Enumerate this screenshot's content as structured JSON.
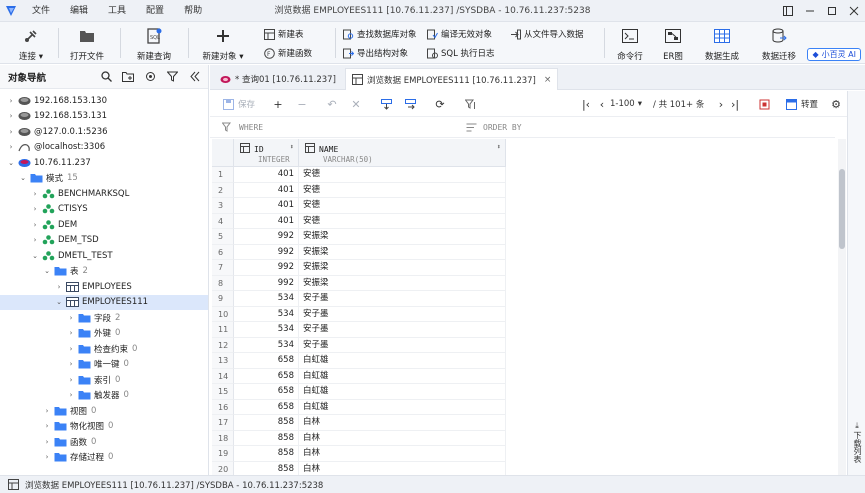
{
  "window": {
    "title": "浏览数据 EMPLOYEES111 [10.76.11.237] /SYSDBA - 10.76.11.237:5238",
    "menu": [
      "文件",
      "编辑",
      "工具",
      "配置",
      "帮助"
    ]
  },
  "toolbar": {
    "connect": "连接",
    "open_file": "打开文件",
    "new_query": "新建查询",
    "new_object": "新建对象",
    "new_table": "新建表",
    "new_function": "新建函数",
    "find_db_object": "查找数据库对象",
    "export_structure": "导出结构对象",
    "compile_invalid": "编译无效对象",
    "sql_log": "SQL 执行日志",
    "import_from_file": "从文件导入数据",
    "command_line": "命令行",
    "er_diagram": "ER图",
    "data_generation": "数据生成",
    "data_migration": "数据迁移",
    "ai_assistant": "小百灵 AI"
  },
  "navigator": {
    "title": "对象导航",
    "tree": [
      {
        "label": "192.168.153.130",
        "level": 0,
        "expanded": false,
        "icon": "server-offline-icon"
      },
      {
        "label": "192.168.153.131",
        "level": 0,
        "expanded": false,
        "icon": "server-offline-icon"
      },
      {
        "label": "@127.0.0.1:5236",
        "level": 0,
        "expanded": false,
        "icon": "server-offline-icon"
      },
      {
        "label": "@localhost:3306",
        "level": 0,
        "expanded": false,
        "icon": "mysql-icon"
      },
      {
        "label": "10.76.11.237",
        "level": 0,
        "expanded": true,
        "icon": "server-online-icon"
      },
      {
        "label": "模式",
        "count": "15",
        "level": 1,
        "expanded": true,
        "icon": "folder-icon"
      },
      {
        "label": "BENCHMARKSQL",
        "level": 2,
        "expanded": false,
        "icon": "schema-icon"
      },
      {
        "label": "CTISYS",
        "level": 2,
        "expanded": false,
        "icon": "schema-icon"
      },
      {
        "label": "DEM",
        "level": 2,
        "expanded": false,
        "icon": "schema-icon"
      },
      {
        "label": "DEM_TSD",
        "level": 2,
        "expanded": false,
        "icon": "schema-icon"
      },
      {
        "label": "DMETL_TEST",
        "level": 2,
        "expanded": true,
        "icon": "schema-icon"
      },
      {
        "label": "表",
        "count": "2",
        "level": 3,
        "expanded": true,
        "icon": "folder-icon"
      },
      {
        "label": "EMPLOYEES",
        "level": 4,
        "expanded": false,
        "icon": "table-icon"
      },
      {
        "label": "EMPLOYEES111",
        "level": 4,
        "expanded": true,
        "icon": "table-icon",
        "selected": true
      },
      {
        "label": "字段",
        "count": "2",
        "level": 5,
        "expanded": false,
        "icon": "folder-icon"
      },
      {
        "label": "外键",
        "count": "0",
        "level": 5,
        "expanded": false,
        "icon": "folder-icon"
      },
      {
        "label": "检查约束",
        "count": "0",
        "level": 5,
        "expanded": false,
        "icon": "folder-icon"
      },
      {
        "label": "唯一键",
        "count": "0",
        "level": 5,
        "expanded": false,
        "icon": "folder-icon"
      },
      {
        "label": "索引",
        "count": "0",
        "level": 5,
        "expanded": false,
        "icon": "folder-icon"
      },
      {
        "label": "触发器",
        "count": "0",
        "level": 5,
        "expanded": false,
        "icon": "folder-icon"
      },
      {
        "label": "视图",
        "count": "0",
        "level": 3,
        "expanded": false,
        "icon": "folder-icon"
      },
      {
        "label": "物化视图",
        "count": "0",
        "level": 3,
        "expanded": false,
        "icon": "folder-icon"
      },
      {
        "label": "函数",
        "count": "0",
        "level": 3,
        "expanded": false,
        "icon": "folder-icon"
      },
      {
        "label": "存储过程",
        "count": "0",
        "level": 3,
        "expanded": false,
        "icon": "folder-icon"
      }
    ]
  },
  "tabs": [
    {
      "label": "* 查询01 [10.76.11.237]",
      "active": false
    },
    {
      "label": "浏览数据 EMPLOYEES111 [10.76.11.237]",
      "active": true
    }
  ],
  "grid_toolbar": {
    "save": "保存",
    "page_range": "1-100",
    "total": "/ 共 101+ 条",
    "transpose": "转置"
  },
  "filter": {
    "where_placeholder": "WHERE",
    "order_placeholder": "ORDER BY"
  },
  "grid": {
    "columns": [
      {
        "name": "ID",
        "type": "INTEGER"
      },
      {
        "name": "NAME",
        "type": "VARCHAR(50)"
      }
    ],
    "rows": [
      {
        "n": "1",
        "id": "401",
        "name": "安德"
      },
      {
        "n": "2",
        "id": "401",
        "name": "安德"
      },
      {
        "n": "3",
        "id": "401",
        "name": "安德"
      },
      {
        "n": "4",
        "id": "401",
        "name": "安德"
      },
      {
        "n": "5",
        "id": "992",
        "name": "安振梁"
      },
      {
        "n": "6",
        "id": "992",
        "name": "安振梁"
      },
      {
        "n": "7",
        "id": "992",
        "name": "安振梁"
      },
      {
        "n": "8",
        "id": "992",
        "name": "安振梁"
      },
      {
        "n": "9",
        "id": "534",
        "name": "安子墨"
      },
      {
        "n": "10",
        "id": "534",
        "name": "安子墨"
      },
      {
        "n": "11",
        "id": "534",
        "name": "安子墨"
      },
      {
        "n": "12",
        "id": "534",
        "name": "安子墨"
      },
      {
        "n": "13",
        "id": "658",
        "name": "白虹雄"
      },
      {
        "n": "14",
        "id": "658",
        "name": "白虹雄"
      },
      {
        "n": "15",
        "id": "658",
        "name": "白虹雄"
      },
      {
        "n": "16",
        "id": "658",
        "name": "白虹雄"
      },
      {
        "n": "17",
        "id": "858",
        "name": "白林"
      },
      {
        "n": "18",
        "id": "858",
        "name": "白林"
      },
      {
        "n": "19",
        "id": "858",
        "name": "白林"
      },
      {
        "n": "20",
        "id": "858",
        "name": "白林"
      }
    ]
  },
  "right_strip": {
    "download_list": "下载列表"
  },
  "status": {
    "text": "浏览数据 EMPLOYEES111 [10.76.11.237] /SYSDBA - 10.76.11.237:5238"
  }
}
